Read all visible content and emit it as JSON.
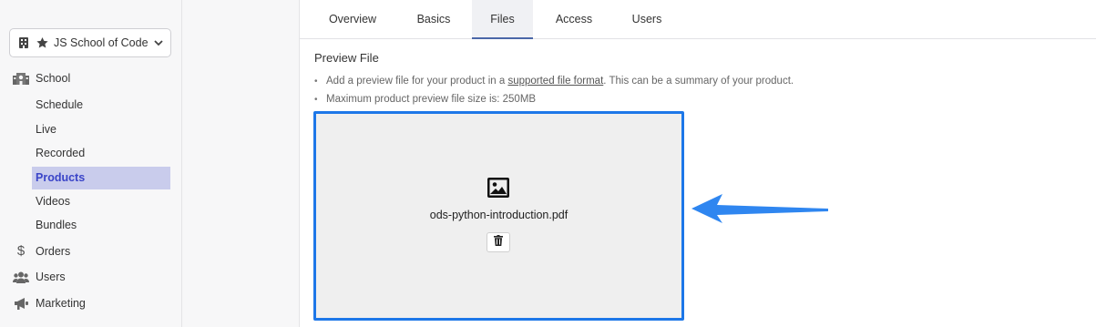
{
  "sidebar": {
    "school_name": "JS School of Code",
    "sections": [
      {
        "label": "School",
        "icon": "school-icon"
      },
      {
        "label": "Orders",
        "icon": "dollar-icon"
      },
      {
        "label": "Users",
        "icon": "users-icon"
      },
      {
        "label": "Marketing",
        "icon": "megaphone-icon"
      }
    ],
    "school_items": [
      {
        "label": "Schedule"
      },
      {
        "label": "Live"
      },
      {
        "label": "Recorded"
      },
      {
        "label": "Products",
        "active": true
      },
      {
        "label": "Videos"
      },
      {
        "label": "Bundles"
      }
    ]
  },
  "tabs": [
    {
      "label": "Overview"
    },
    {
      "label": "Basics"
    },
    {
      "label": "Files",
      "active": true
    },
    {
      "label": "Access"
    },
    {
      "label": "Users"
    }
  ],
  "preview": {
    "title": "Preview File",
    "bullet1_prefix": "Add a preview file for your product in a ",
    "bullet1_link": "supported file format",
    "bullet1_suffix": ". This can be a summary of your product.",
    "bullet2": "Maximum product preview file size is: 250MB",
    "file_name": "ods-python-introduction.pdf"
  },
  "colors": {
    "accent": "#1d77e8",
    "active_nav_bg": "#c9ccec",
    "active_nav_text": "#3a44c8",
    "arrow": "#2f86f0"
  }
}
